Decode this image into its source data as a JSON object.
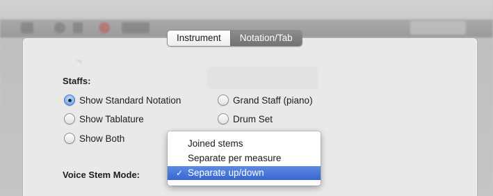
{
  "tabs": [
    {
      "label": "Instrument",
      "selected": false
    },
    {
      "label": "Notation/Tab",
      "selected": true
    }
  ],
  "staffs": {
    "heading": "Staffs:",
    "options": [
      {
        "label": "Show Standard Notation",
        "checked": true
      },
      {
        "label": "Grand Staff (piano)",
        "checked": false
      },
      {
        "label": "Show Tablature",
        "checked": false
      },
      {
        "label": "Drum Set",
        "checked": false
      },
      {
        "label": "Show Both",
        "checked": false
      }
    ]
  },
  "voice_stem": {
    "label": "Voice Stem Mode:",
    "menu_items": [
      {
        "label": "Joined stems",
        "selected": false
      },
      {
        "label": "Separate per measure",
        "selected": false
      },
      {
        "label": "Separate up/down",
        "selected": true
      }
    ],
    "check_glyph": "✓"
  },
  "colors": {
    "selected_tab": "#7f7f7f",
    "radio_checked": "#5a8bd6",
    "menu_highlight": "#3966cf"
  }
}
